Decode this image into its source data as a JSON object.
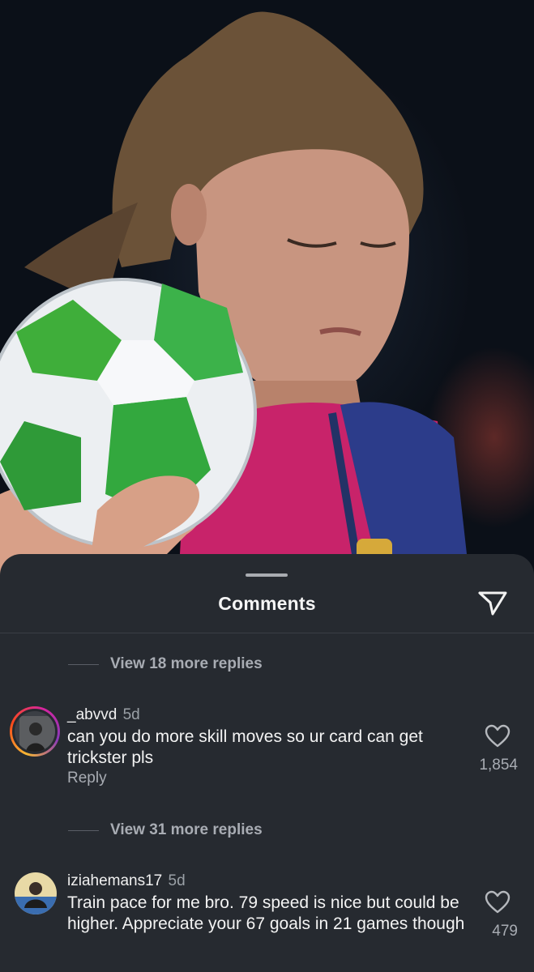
{
  "sheet": {
    "title": "Comments",
    "share_icon": "send-icon"
  },
  "replies_1": {
    "label": "View 18 more replies"
  },
  "replies_2": {
    "label": "View 31 more replies"
  },
  "comments": [
    {
      "username": "_abvvd",
      "time": "5d",
      "text": "can you do more skill moves so ur card can get trickster pls",
      "likes": "1,854",
      "reply_label": "Reply",
      "has_story": true
    },
    {
      "username": "iziahemans17",
      "time": "5d",
      "text": "Train pace for me bro. 79 speed is nice but could be higher. Appreciate your 67 goals in 21 games though",
      "likes": "479",
      "has_story": false
    }
  ],
  "colors": {
    "sheet_bg": "#262a30",
    "text_primary": "#f3f3f3",
    "text_secondary": "#a8acb3"
  }
}
